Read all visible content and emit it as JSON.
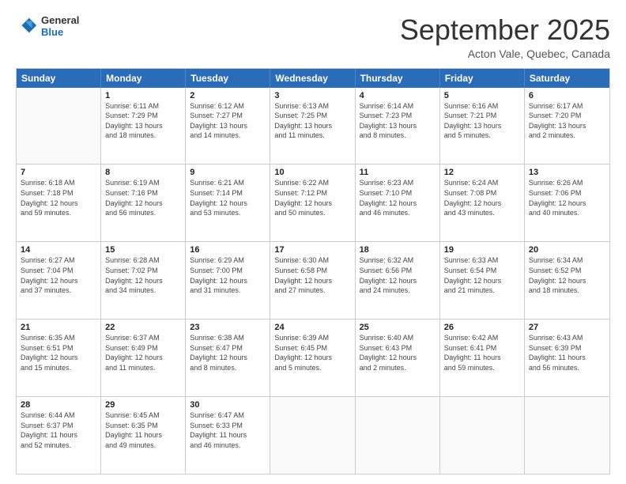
{
  "logo": {
    "line1": "General",
    "line2": "Blue"
  },
  "header": {
    "month": "September 2025",
    "location": "Acton Vale, Quebec, Canada"
  },
  "weekdays": [
    "Sunday",
    "Monday",
    "Tuesday",
    "Wednesday",
    "Thursday",
    "Friday",
    "Saturday"
  ],
  "weeks": [
    [
      {
        "day": "",
        "info": ""
      },
      {
        "day": "1",
        "info": "Sunrise: 6:11 AM\nSunset: 7:29 PM\nDaylight: 13 hours\nand 18 minutes."
      },
      {
        "day": "2",
        "info": "Sunrise: 6:12 AM\nSunset: 7:27 PM\nDaylight: 13 hours\nand 14 minutes."
      },
      {
        "day": "3",
        "info": "Sunrise: 6:13 AM\nSunset: 7:25 PM\nDaylight: 13 hours\nand 11 minutes."
      },
      {
        "day": "4",
        "info": "Sunrise: 6:14 AM\nSunset: 7:23 PM\nDaylight: 13 hours\nand 8 minutes."
      },
      {
        "day": "5",
        "info": "Sunrise: 6:16 AM\nSunset: 7:21 PM\nDaylight: 13 hours\nand 5 minutes."
      },
      {
        "day": "6",
        "info": "Sunrise: 6:17 AM\nSunset: 7:20 PM\nDaylight: 13 hours\nand 2 minutes."
      }
    ],
    [
      {
        "day": "7",
        "info": "Sunrise: 6:18 AM\nSunset: 7:18 PM\nDaylight: 12 hours\nand 59 minutes."
      },
      {
        "day": "8",
        "info": "Sunrise: 6:19 AM\nSunset: 7:16 PM\nDaylight: 12 hours\nand 56 minutes."
      },
      {
        "day": "9",
        "info": "Sunrise: 6:21 AM\nSunset: 7:14 PM\nDaylight: 12 hours\nand 53 minutes."
      },
      {
        "day": "10",
        "info": "Sunrise: 6:22 AM\nSunset: 7:12 PM\nDaylight: 12 hours\nand 50 minutes."
      },
      {
        "day": "11",
        "info": "Sunrise: 6:23 AM\nSunset: 7:10 PM\nDaylight: 12 hours\nand 46 minutes."
      },
      {
        "day": "12",
        "info": "Sunrise: 6:24 AM\nSunset: 7:08 PM\nDaylight: 12 hours\nand 43 minutes."
      },
      {
        "day": "13",
        "info": "Sunrise: 6:26 AM\nSunset: 7:06 PM\nDaylight: 12 hours\nand 40 minutes."
      }
    ],
    [
      {
        "day": "14",
        "info": "Sunrise: 6:27 AM\nSunset: 7:04 PM\nDaylight: 12 hours\nand 37 minutes."
      },
      {
        "day": "15",
        "info": "Sunrise: 6:28 AM\nSunset: 7:02 PM\nDaylight: 12 hours\nand 34 minutes."
      },
      {
        "day": "16",
        "info": "Sunrise: 6:29 AM\nSunset: 7:00 PM\nDaylight: 12 hours\nand 31 minutes."
      },
      {
        "day": "17",
        "info": "Sunrise: 6:30 AM\nSunset: 6:58 PM\nDaylight: 12 hours\nand 27 minutes."
      },
      {
        "day": "18",
        "info": "Sunrise: 6:32 AM\nSunset: 6:56 PM\nDaylight: 12 hours\nand 24 minutes."
      },
      {
        "day": "19",
        "info": "Sunrise: 6:33 AM\nSunset: 6:54 PM\nDaylight: 12 hours\nand 21 minutes."
      },
      {
        "day": "20",
        "info": "Sunrise: 6:34 AM\nSunset: 6:52 PM\nDaylight: 12 hours\nand 18 minutes."
      }
    ],
    [
      {
        "day": "21",
        "info": "Sunrise: 6:35 AM\nSunset: 6:51 PM\nDaylight: 12 hours\nand 15 minutes."
      },
      {
        "day": "22",
        "info": "Sunrise: 6:37 AM\nSunset: 6:49 PM\nDaylight: 12 hours\nand 11 minutes."
      },
      {
        "day": "23",
        "info": "Sunrise: 6:38 AM\nSunset: 6:47 PM\nDaylight: 12 hours\nand 8 minutes."
      },
      {
        "day": "24",
        "info": "Sunrise: 6:39 AM\nSunset: 6:45 PM\nDaylight: 12 hours\nand 5 minutes."
      },
      {
        "day": "25",
        "info": "Sunrise: 6:40 AM\nSunset: 6:43 PM\nDaylight: 12 hours\nand 2 minutes."
      },
      {
        "day": "26",
        "info": "Sunrise: 6:42 AM\nSunset: 6:41 PM\nDaylight: 11 hours\nand 59 minutes."
      },
      {
        "day": "27",
        "info": "Sunrise: 6:43 AM\nSunset: 6:39 PM\nDaylight: 11 hours\nand 56 minutes."
      }
    ],
    [
      {
        "day": "28",
        "info": "Sunrise: 6:44 AM\nSunset: 6:37 PM\nDaylight: 11 hours\nand 52 minutes."
      },
      {
        "day": "29",
        "info": "Sunrise: 6:45 AM\nSunset: 6:35 PM\nDaylight: 11 hours\nand 49 minutes."
      },
      {
        "day": "30",
        "info": "Sunrise: 6:47 AM\nSunset: 6:33 PM\nDaylight: 11 hours\nand 46 minutes."
      },
      {
        "day": "",
        "info": ""
      },
      {
        "day": "",
        "info": ""
      },
      {
        "day": "",
        "info": ""
      },
      {
        "day": "",
        "info": ""
      }
    ]
  ]
}
